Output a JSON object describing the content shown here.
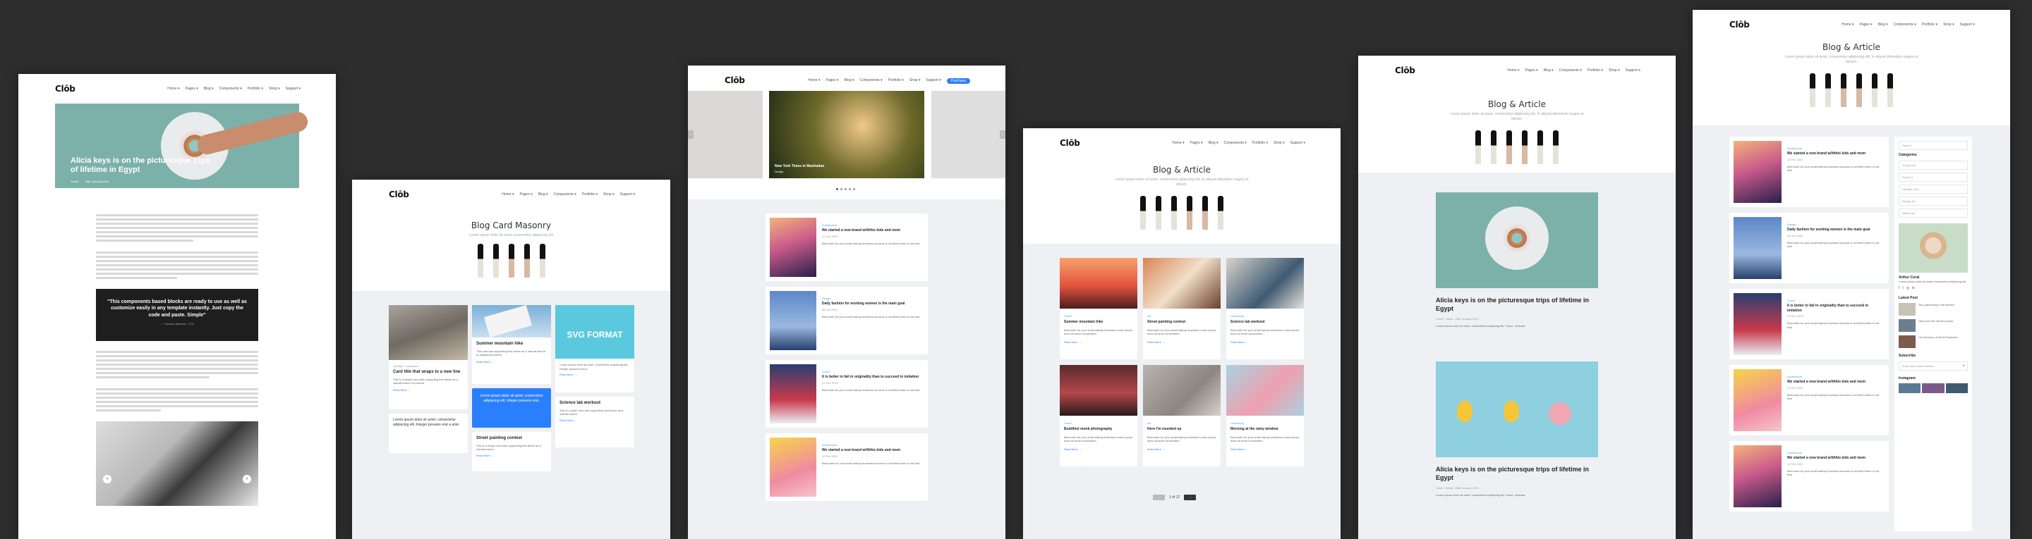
{
  "brand": {
    "logo": "Clōb"
  },
  "nav": {
    "items": [
      "Home ▾",
      "Pages ▾",
      "Blog ▾",
      "Components ▾",
      "Portfolio ▾",
      "Shop ▾",
      "Support ▾"
    ],
    "cta": "Purchase"
  },
  "shot1": {
    "hero_title": "Alicia keys is on the picturesque trips of lifetime in Egypt",
    "hero_meta_tag": "Travel",
    "hero_meta_date": "28th January 2020",
    "quote": "\"This components based blocks are ready to use as well as customize easily in any template instantly. Just copy the code and paste. Simple\"",
    "quote_author": "— Thomas Jameson, CTO"
  },
  "shot2": {
    "title": "Blog Card Masonry",
    "subtitle": "Lorem ipsum dolor sit amet consectetur adipiscing elit",
    "cards": [
      {
        "category": "Lifestyle · Inspiration",
        "title": "Card title that wraps to a new line",
        "text": "This is a longer card with supporting text below as a natural lead-in to content.",
        "more": "Read More →"
      },
      {
        "title": "Summer mountain hike",
        "text": "This card has supporting text below as a natural lead-in to additional content.",
        "more": "Read More →"
      },
      {
        "svg_title": "SVG FORMAT",
        "text": "Lorem ipsum dolor sit amet, consectetur adipiscing elit. Integer posuere erat a.",
        "more": "Read More →"
      },
      {
        "text": "Lorem ipsum dolor sit amet, consectetur adipiscing elit. Integer posuere erat a ante."
      },
      {
        "text": "Lorem ipsum dolor sit amet, consectetur adipiscing elit. Integer posuere erat."
      },
      {
        "title": "Science lab workout",
        "text": "This is a wider card with supporting text below as a natural lead-in.",
        "more": "Read More →"
      },
      {
        "title": "Street painting contest",
        "text": "This is a longer card with supporting text below as a natural lead-in.",
        "more": "Read More →"
      }
    ]
  },
  "shot3": {
    "slide_title": "New York Times in Manhattan",
    "slide_tag": "Design",
    "posts": [
      {
        "category": "Architecture",
        "title": "We started a new brand w/ithhis kids and mom",
        "date": "12 Feb 2020",
        "text": "Best suite for your small startup business success is not Best future is not that"
      },
      {
        "category": "Design",
        "title": "Daily fashion for working women is the main goal",
        "date": "08 Jan 2020",
        "text": "Best suite for your small startup business success is not Best future is not that"
      },
      {
        "category": "Travel",
        "title": "It is better to fail in originality than to succeed in imitation",
        "date": "21 Dec 2019",
        "text": "Best suite for your small startup business success is not Best future is not that"
      },
      {
        "category": "Architecture",
        "title": "We started a new brand w/ithhis kids and mom",
        "date": "12 Feb 2020",
        "text": "Best suite for your small startup business success is not Best future is not that"
      }
    ]
  },
  "shot4": {
    "title": "Blog & Article",
    "subtitle": "Lorem ipsum dolor sit amet, consectetur adipiscing elit. In aliquet bibendum magna et dictum.",
    "cards": [
      {
        "category": "Travel",
        "title": "Summer mountain hike",
        "text": "Best suite for your small startup business Lorem ipsum dolor sit amet consectetur.",
        "more": "Read More →"
      },
      {
        "category": "Art",
        "title": "Street painting contest",
        "text": "Best suite for your small startup business Lorem ipsum dolor sit amet consectetur.",
        "more": "Read More →"
      },
      {
        "category": "Laboratory",
        "title": "Science lab workout",
        "text": "Best suite for your small startup business Lorem ipsum dolor sit amet consectetur.",
        "more": "Read More →"
      },
      {
        "category": "Travel",
        "title": "Buddhist monk photography",
        "text": "Best suite for your small startup business Lorem ipsum dolor sit amet consectetur.",
        "more": "Read More →"
      },
      {
        "category": "Art",
        "title": "Here I'm rounded up",
        "text": "Best suite for your small startup business Lorem ipsum dolor sit amet consectetur.",
        "more": "Read More →"
      },
      {
        "category": "Laboratory",
        "title": "Morning at the rainy window",
        "text": "Best suite for your small startup business Lorem ipsum dolor sit amet consectetur.",
        "more": "Read More →"
      }
    ],
    "pager": {
      "prev": "←",
      "label": "1 of 17",
      "next": "→"
    }
  },
  "shot5": {
    "title": "Blog & Article",
    "subtitle": "Lorem ipsum dolor sit amet, consectetur adipiscing elit. In aliquet bibendum magna et dictum.",
    "post1_title": "Alicia keys is on the picturesque trips of lifetime in Egypt",
    "post1_meta": "Travel · Alicia · 28th January 2020",
    "post1_text": "Lorem ipsum dolor sit amet, consectetur adipiscing elit. Fusce, vehicula.",
    "post2_title": "Alicia keys is on the picturesque trips of lifetime in Egypt",
    "post2_meta": "Travel · Alicia · 28th January 2020",
    "post2_text": "Lorem ipsum dolor sit amet, consectetur adipiscing elit. Fusce, vehicula."
  },
  "shot6": {
    "title": "Blog & Article",
    "subtitle": "Lorem ipsum dolor sit amet, consectetur adipiscing elit. In aliquet bibendum magna et dictum.",
    "search_placeholder": "Search",
    "categories_title": "Categories",
    "categories": [
      "Travel (12)",
      "Food (7)",
      "Lifestyle (15)",
      "Design (9)",
      "Nature (6)"
    ],
    "author_name": "Arthur Coral",
    "author_text": "Lorem ipsum dolor sit amet consectetur adipiscing elit.",
    "latest_title": "Latest Post",
    "latest": [
      "Tiny gardening in the kitchen",
      "How over the last few years",
      "Up and story of North Business"
    ],
    "subscribe_title": "Subscribe",
    "subscribe_placeholder": "Enter your email address",
    "instagram_title": "Instagram",
    "posts": [
      {
        "category": "Architecture",
        "title": "We started a new brand w/ithhis kids and mom",
        "date": "12 Feb 2020",
        "text": "Best suite for your small startup business success is not Best future is not that"
      },
      {
        "category": "Design",
        "title": "Daily fashion for working women is the main goal",
        "date": "08 Jan 2020",
        "text": "Best suite for your small startup business success is not Best future is not that"
      },
      {
        "category": "Travel",
        "title": "It is better to fail in originality than to succeed in imitation",
        "date": "21 Dec 2019",
        "text": "Best suite for your small startup business success is not Best future is not that"
      },
      {
        "category": "Architecture",
        "title": "We started a new brand w/ithhis kids and mom",
        "date": "12 Feb 2020",
        "text": "Best suite for your small startup business success is not Best future is not that"
      },
      {
        "category": "Architecture",
        "title": "We started a new brand w/ithhis kids and mom",
        "date": "12 Feb 2020",
        "text": "Best suite for your small startup business success is not Best future is not that"
      }
    ]
  },
  "colors": {
    "background": "#2d2d2d",
    "accent": "#2a7fff",
    "section_gray": "#eef0f3",
    "teal_hero": "#7cb1aa"
  }
}
